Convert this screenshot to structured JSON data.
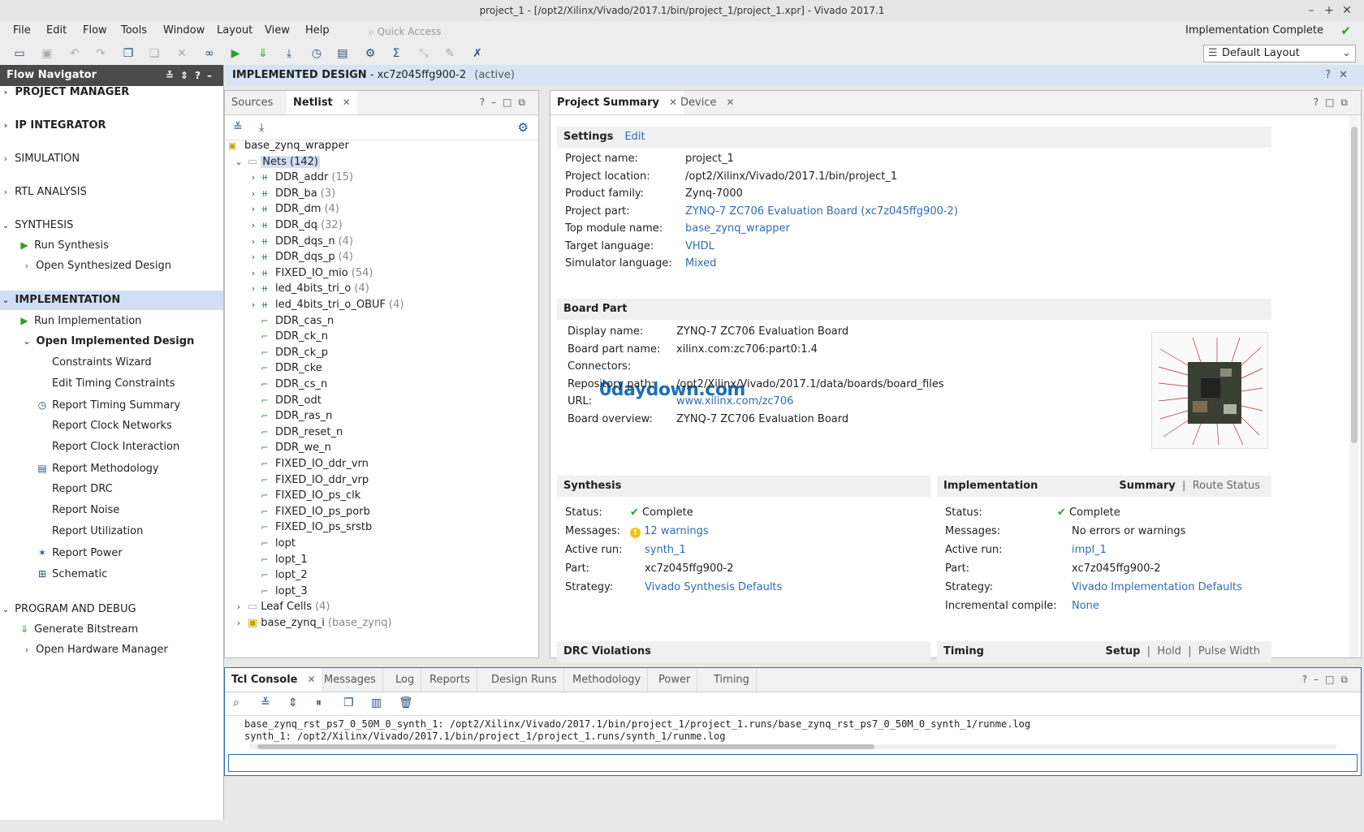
{
  "window": {
    "title": "project_1 - [/opt2/Xilinx/Vivado/2017.1/bin/project_1/project_1.xpr] - Vivado 2017.1"
  },
  "menu": {
    "items": [
      "File",
      "Edit",
      "Flow",
      "Tools",
      "Window",
      "Layout",
      "View",
      "Help"
    ],
    "quick_access": "Quick Access"
  },
  "status": {
    "impl": "Implementation Complete"
  },
  "layout_select": {
    "value": "Default Layout"
  },
  "flow_nav": {
    "title": "Flow Navigator",
    "project_manager": "PROJECT MANAGER",
    "ip_integrator": "IP INTEGRATOR",
    "simulation": "SIMULATION",
    "rtl_analysis": "RTL ANALYSIS",
    "synthesis": "SYNTHESIS",
    "run_synthesis": "Run Synthesis",
    "open_synth": "Open Synthesized Design",
    "implementation": "IMPLEMENTATION",
    "run_impl": "Run Implementation",
    "open_impl": "Open Implemented Design",
    "constraints_wizard": "Constraints Wizard",
    "edit_timing": "Edit Timing Constraints",
    "report_timing": "Report Timing Summary",
    "report_clock_networks": "Report Clock Networks",
    "report_clock_interaction": "Report Clock Interaction",
    "report_methodology": "Report Methodology",
    "report_drc": "Report DRC",
    "report_noise": "Report Noise",
    "report_utilization": "Report Utilization",
    "report_power": "Report Power",
    "schematic": "Schematic",
    "program_debug": "PROGRAM AND DEBUG",
    "gen_bitstream": "Generate Bitstream",
    "open_hw": "Open Hardware Manager"
  },
  "design_header": {
    "label": "IMPLEMENTED DESIGN",
    "part": " - xc7z045ffg900-2",
    "state": "(active)"
  },
  "netlist_panel": {
    "tab_sources": "Sources",
    "tab_netlist": "Netlist",
    "root": "base_zynq_wrapper",
    "nets_label": "Nets (142)",
    "bus_nets": [
      {
        "name": "DDR_addr",
        "count": "(15)"
      },
      {
        "name": "DDR_ba",
        "count": "(3)"
      },
      {
        "name": "DDR_dm",
        "count": "(4)"
      },
      {
        "name": "DDR_dq",
        "count": "(32)"
      },
      {
        "name": "DDR_dqs_n",
        "count": "(4)"
      },
      {
        "name": "DDR_dqs_p",
        "count": "(4)"
      },
      {
        "name": "FIXED_IO_mio",
        "count": "(54)"
      },
      {
        "name": "led_4bits_tri_o",
        "count": "(4)"
      },
      {
        "name": "led_4bits_tri_o_OBUF",
        "count": "(4)"
      }
    ],
    "nets": [
      "DDR_cas_n",
      "DDR_ck_n",
      "DDR_ck_p",
      "DDR_cke",
      "DDR_cs_n",
      "DDR_odt",
      "DDR_ras_n",
      "DDR_reset_n",
      "DDR_we_n",
      "FIXED_IO_ddr_vrn",
      "FIXED_IO_ddr_vrp",
      "FIXED_IO_ps_clk",
      "FIXED_IO_ps_porb",
      "FIXED_IO_ps_srstb",
      "lopt",
      "lopt_1",
      "lopt_2",
      "lopt_3"
    ],
    "leaf_cells": "Leaf Cells",
    "leaf_count": "(4)",
    "instance": "base_zynq_i",
    "instance_type": "(base_zynq)"
  },
  "summary_panel": {
    "tab_summary": "Project Summary",
    "tab_device": "Device",
    "settings": {
      "title": "Settings",
      "edit": "Edit",
      "rows": [
        {
          "label": "Project name:",
          "value": "project_1",
          "link": false
        },
        {
          "label": "Project location:",
          "value": "/opt2/Xilinx/Vivado/2017.1/bin/project_1",
          "link": false
        },
        {
          "label": "Product family:",
          "value": "Zynq-7000",
          "link": false
        },
        {
          "label": "Project part:",
          "value": "ZYNQ-7 ZC706 Evaluation Board (xc7z045ffg900-2)",
          "link": true
        },
        {
          "label": "Top module name:",
          "value": "base_zynq_wrapper",
          "link": true
        },
        {
          "label": "Target language:",
          "value": "VHDL",
          "link": true
        },
        {
          "label": "Simulator language:",
          "value": "Mixed",
          "link": true
        }
      ]
    },
    "board": {
      "title": "Board Part",
      "rows": [
        {
          "label": "Display name:",
          "value": "ZYNQ-7 ZC706 Evaluation Board",
          "link": false
        },
        {
          "label": "Board part name:",
          "value": "xilinx.com:zc706:part0:1.4",
          "link": false
        },
        {
          "label": "Connectors:",
          "value": "",
          "link": false
        },
        {
          "label": "Repository path:",
          "value": "/opt2/Xilinx/Vivado/2017.1/data/boards/board_files",
          "link": false
        },
        {
          "label": "URL:",
          "value": "www.xilinx.com/zc706",
          "link": true
        },
        {
          "label": "Board overview:",
          "value": "ZYNQ-7 ZC706 Evaluation Board",
          "link": false
        }
      ]
    },
    "synthesis": {
      "title": "Synthesis",
      "status_label": "Status:",
      "status": "Complete",
      "messages_label": "Messages:",
      "messages": "12 warnings",
      "run_label": "Active run:",
      "run": "synth_1",
      "part_label": "Part:",
      "part": "xc7z045ffg900-2",
      "strategy_label": "Strategy:",
      "strategy": "Vivado Synthesis Defaults"
    },
    "implementation": {
      "title": "Implementation",
      "tab_summary": "Summary",
      "tab_route": "Route Status",
      "status_label": "Status:",
      "status": "Complete",
      "messages_label": "Messages:",
      "messages": "No errors or warnings",
      "run_label": "Active run:",
      "run": "impl_1",
      "part_label": "Part:",
      "part": "xc7z045ffg900-2",
      "strategy_label": "Strategy:",
      "strategy": "Vivado Implementation Defaults",
      "incremental_label": "Incremental compile:",
      "incremental": "None"
    },
    "drc": {
      "title": "DRC Violations"
    },
    "timing": {
      "title": "Timing",
      "setup": "Setup",
      "hold": "Hold",
      "pulse": "Pulse Width"
    }
  },
  "watermark": "0daydown.com",
  "console": {
    "tabs": [
      "Tcl Console",
      "Messages",
      "Log",
      "Reports",
      "Design Runs",
      "Methodology",
      "Power",
      "Timing"
    ],
    "lines": [
      "base_zynq_rst_ps7_0_50M_0_synth_1: /opt2/Xilinx/Vivado/2017.1/bin/project_1/project_1.runs/base_zynq_rst_ps7_0_50M_0_synth_1/runme.log",
      "synth_1: /opt2/Xilinx/Vivado/2017.1/bin/project_1/project_1.runs/synth_1/runme.log"
    ]
  }
}
